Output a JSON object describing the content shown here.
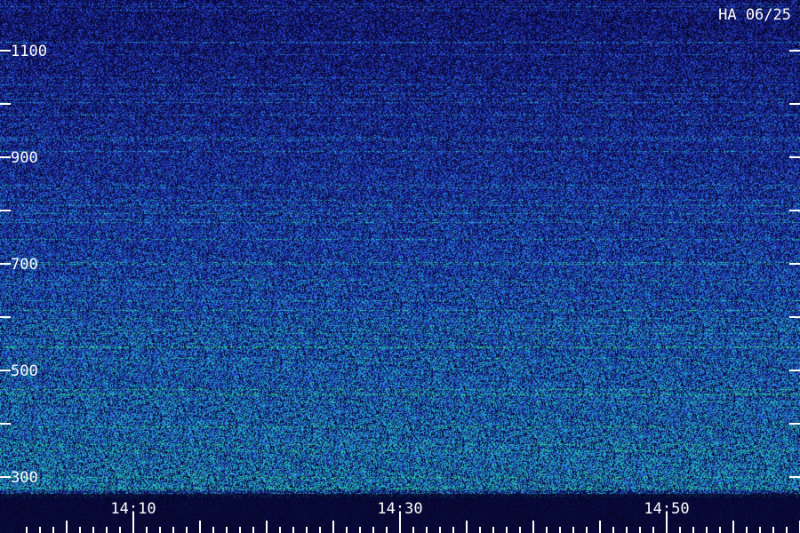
{
  "station_label": "HA 06/25",
  "chart_data": {
    "type": "heatmap",
    "title": "",
    "xlabel": "",
    "ylabel": "",
    "x_tick_labels": [
      "14:10",
      "14:30",
      "14:50"
    ],
    "x_tick_values_min": [
      10,
      30,
      50
    ],
    "x_range_min": [
      2,
      60
    ],
    "x_minor_step_min": 5,
    "y_tick_labels": [
      "1100",
      "900",
      "700",
      "500",
      "300"
    ],
    "y_tick_values": [
      1100,
      900,
      700,
      500,
      300
    ],
    "y_minor_ticks": [
      1200,
      1000,
      800,
      600,
      400
    ],
    "y_range": [
      260,
      1200
    ],
    "colormap": [
      "#06062a",
      "#1a1ea0",
      "#2a4fd8",
      "#1e8fd0",
      "#22c0b0",
      "#3ee07a"
    ],
    "intensity_profile": "increasing toward low values; strongest near 300, weakest near 1200"
  }
}
